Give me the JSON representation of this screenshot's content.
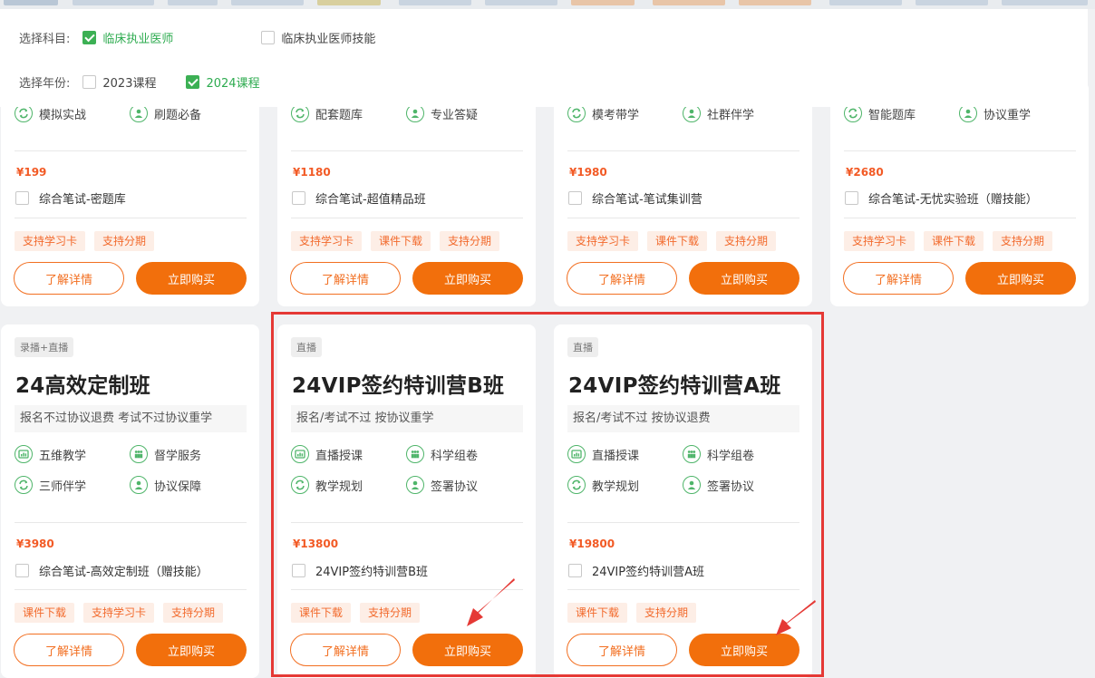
{
  "filter": {
    "subject_label": "选择科目:",
    "subject_options": [
      {
        "label": "临床执业医师",
        "checked": true
      },
      {
        "label": "临床执业医师技能",
        "checked": false
      }
    ],
    "year_label": "选择年份:",
    "year_options": [
      {
        "label": "2023课程",
        "checked": false
      },
      {
        "label": "2024课程",
        "checked": true
      }
    ]
  },
  "top_cards": [
    {
      "features": [
        {
          "icon": "refresh-icon",
          "label": "模拟实战"
        },
        {
          "icon": "user-icon",
          "label": "刷题必备"
        }
      ],
      "price": "¥199",
      "package": "综合笔试-密题库",
      "chips": [
        "支持学习卡",
        "支持分期"
      ],
      "detail_label": "了解详情",
      "buy_label": "立即购买"
    },
    {
      "features": [
        {
          "icon": "refresh-icon",
          "label": "配套题库"
        },
        {
          "icon": "user-icon",
          "label": "专业答疑"
        }
      ],
      "price": "¥1180",
      "package": "综合笔试-超值精品班",
      "chips": [
        "支持学习卡",
        "课件下载",
        "支持分期"
      ],
      "detail_label": "了解详情",
      "buy_label": "立即购买"
    },
    {
      "features": [
        {
          "icon": "refresh-icon",
          "label": "模考带学"
        },
        {
          "icon": "user-icon",
          "label": "社群伴学"
        }
      ],
      "price": "¥1980",
      "package": "综合笔试-笔试集训营",
      "chips": [
        "支持学习卡",
        "课件下载",
        "支持分期"
      ],
      "detail_label": "了解详情",
      "buy_label": "立即购买"
    },
    {
      "features": [
        {
          "icon": "refresh-icon",
          "label": "智能题库"
        },
        {
          "icon": "user-icon",
          "label": "协议重学"
        }
      ],
      "price": "¥2680",
      "package": "综合笔试-无忧实验班（赠技能）",
      "chips": [
        "支持学习卡",
        "课件下载",
        "支持分期"
      ],
      "detail_label": "了解详情",
      "buy_label": "立即购买"
    }
  ],
  "bottom_cards": [
    {
      "tag": "录播+直播",
      "title": "24高效定制班",
      "subtitle": "报名不过协议退费 考试不过协议重学",
      "features": [
        {
          "icon": "grid-icon",
          "label": "五维教学"
        },
        {
          "icon": "group-icon",
          "label": "督学服务"
        },
        {
          "icon": "refresh-icon",
          "label": "三师伴学"
        },
        {
          "icon": "user-icon",
          "label": "协议保障"
        }
      ],
      "price": "¥3980",
      "package": "综合笔试-高效定制班（赠技能）",
      "chips": [
        "课件下载",
        "支持学习卡",
        "支持分期"
      ],
      "detail_label": "了解详情",
      "buy_label": "立即购买"
    },
    {
      "tag": "直播",
      "title": "24VIP签约特训营B班",
      "subtitle": "报名/考试不过 按协议重学",
      "features": [
        {
          "icon": "grid-icon",
          "label": "直播授课"
        },
        {
          "icon": "group-icon",
          "label": "科学组卷"
        },
        {
          "icon": "refresh-icon",
          "label": "教学规划"
        },
        {
          "icon": "user-icon",
          "label": "签署协议"
        }
      ],
      "price": "¥13800",
      "package": "24VIP签约特训营B班",
      "chips": [
        "课件下载",
        "支持分期"
      ],
      "detail_label": "了解详情",
      "buy_label": "立即购买"
    },
    {
      "tag": "直播",
      "title": "24VIP签约特训营A班",
      "subtitle": "报名/考试不过 按协议退费",
      "features": [
        {
          "icon": "grid-icon",
          "label": "直播授课"
        },
        {
          "icon": "group-icon",
          "label": "科学组卷"
        },
        {
          "icon": "refresh-icon",
          "label": "教学规划"
        },
        {
          "icon": "user-icon",
          "label": "签署协议"
        }
      ],
      "price": "¥19800",
      "package": "24VIP签约特训营A班",
      "chips": [
        "课件下载",
        "支持分期"
      ],
      "detail_label": "了解详情",
      "buy_label": "立即购买"
    }
  ],
  "colors": {
    "accent": "#f26f0c",
    "check_green": "#3cb054",
    "icon_green": "#4fb56a",
    "price_red": "#f25a25",
    "highlight_box": "#e53935"
  }
}
